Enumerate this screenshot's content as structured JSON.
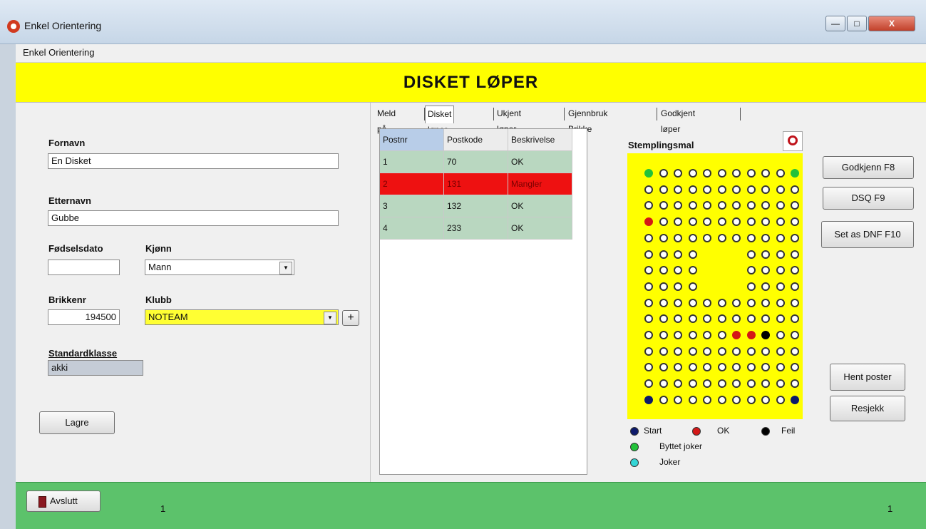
{
  "window": {
    "title": "Enkel Orientering",
    "min": "—",
    "max": "□",
    "close": "X"
  },
  "menu": {
    "item": "Enkel Orientering"
  },
  "banner": {
    "title": "DISKET LØPER"
  },
  "form": {
    "first_name_label": "Fornavn",
    "first_name": "En Disket",
    "last_name_label": "Etternavn",
    "last_name": "Gubbe",
    "birth_label": "Fødselsdato",
    "birth": "",
    "gender_label": "Kjønn",
    "gender": "Mann",
    "chip_label": "Brikkenr",
    "chip": "194500",
    "club_label": "Klubb",
    "club": "NOTEAM",
    "add_club": "+",
    "class_label": "Standardklasse",
    "class": "akki",
    "save": "Lagre"
  },
  "tabs": [
    "Meld på",
    "Disket løper",
    "Ukjent løper",
    "Gjennbruk Brikke",
    "Godkjent løper"
  ],
  "table": {
    "headers": [
      "Postnr",
      "Postkode",
      "Beskrivelse"
    ],
    "rows": [
      {
        "c": [
          "1",
          "70",
          "OK"
        ],
        "status": "ok"
      },
      {
        "c": [
          "2",
          "131",
          "Mangler"
        ],
        "status": "bad"
      },
      {
        "c": [
          "3",
          "132",
          "OK"
        ],
        "status": "ok"
      },
      {
        "c": [
          "4",
          "233",
          "OK"
        ],
        "status": "ok"
      }
    ]
  },
  "stamp": {
    "title": "Stemplingsmal",
    "colors": {
      "start": "#0d1a6b",
      "ok": "#d41717",
      "error": "#000000",
      "replaced": "#22c23a",
      "joker": "#33d6d6",
      "empty": "#ffffff"
    },
    "grid_rows": [
      "G.........G",
      "...........",
      "...........",
      "R..........",
      "...........",
      "....___....",
      "....___....",
      "....___....",
      "...........",
      "...........",
      "......RRK..",
      "...........",
      "...........",
      "...........",
      "B.........B"
    ],
    "legend": {
      "start": "Start",
      "ok": "OK",
      "error": "Feil",
      "replaced": "Byttet joker",
      "joker": "Joker"
    }
  },
  "actions": {
    "approve": "Godkjenn F8",
    "dsq": "DSQ F9",
    "dnf": "Set as DNF F10",
    "fetch": "Hent poster",
    "recheck": "Resjekk"
  },
  "footer": {
    "exit": "Avslutt",
    "left_count": "1",
    "right_count": "1"
  }
}
